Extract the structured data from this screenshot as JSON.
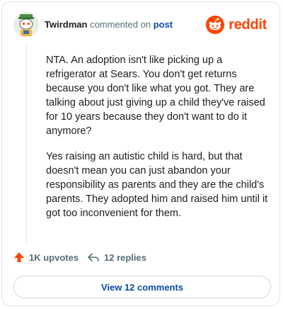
{
  "header": {
    "username": "Twirdman",
    "action_text": "commented on",
    "link_text": "post",
    "brand": "reddit"
  },
  "comment": {
    "paragraphs": [
      "NTA. An adoption isn't like picking up a refrigerator at Sears. You don't get returns because you don't like what you got. They are talking about just giving up a child they've raised for 10 years because they don't want to do it anymore?",
      "Yes raising an autistic child is hard, but that doesn't mean you can just abandon your responsibility as parents and they are the child's parents. They adopted him and raised him until it got too inconvenient for them."
    ]
  },
  "stats": {
    "upvotes": "1K upvotes",
    "replies": "12 replies"
  },
  "view_comments_label": "View 12 comments",
  "colors": {
    "brand": "#ff4500",
    "link": "#0a4bab",
    "muted": "#576f76"
  },
  "icons": {
    "avatar": "snoo-avatar",
    "logo": "reddit-logo-icon",
    "upvote": "upvote-arrow-icon",
    "reply": "reply-arrow-icon"
  }
}
